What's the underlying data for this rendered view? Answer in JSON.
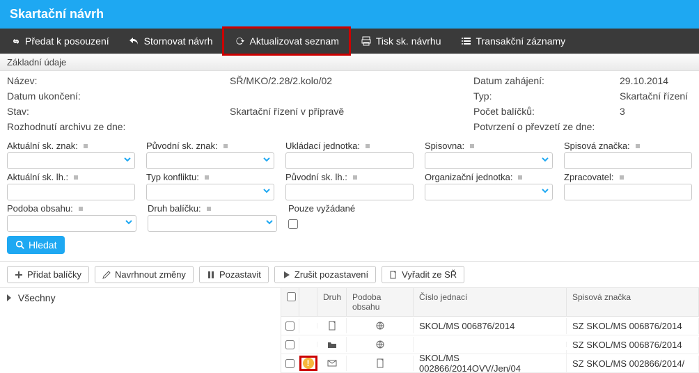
{
  "titlebar": {
    "title": "Skartační návrh"
  },
  "toolbar": {
    "submit": "Předat k posouzení",
    "cancel": "Stornovat návrh",
    "refresh": "Aktualizovat seznam",
    "print": "Tisk sk. návrhu",
    "log": "Transakční záznamy"
  },
  "section": {
    "basic": "Základní údaje"
  },
  "details": {
    "name_label": "Název:",
    "name_value": "SŘ/MKO/2.28/2.kolo/02",
    "start_label": "Datum zahájení:",
    "start_value": "29.10.2014",
    "end_label": "Datum ukončení:",
    "type_label": "Typ:",
    "type_value": "Skartační řízení",
    "state_label": "Stav:",
    "state_value": "Skartační řízení v přípravě",
    "count_label": "Počet balíčků:",
    "count_value": "3",
    "dec_label": "Rozhodnutí archivu ze dne:",
    "conf_label": "Potvrzení o převzetí ze dne:"
  },
  "filters": {
    "akt_znak": "Aktuální sk. znak:",
    "puv_znak": "Původní sk. znak:",
    "ukl_j": "Ukládací jednotka:",
    "spisovna": "Spisovna:",
    "sp_znacka": "Spisová značka:",
    "akt_lh": "Aktuální sk. lh.:",
    "typ_konf": "Typ konfliktu:",
    "puv_lh": "Původní sk. lh.:",
    "org_j": "Organizační jednotka:",
    "zprac": "Zpracovatel:",
    "podoba": "Podoba obsahu:",
    "druh_b": "Druh balíčku:",
    "pouze": "Pouze vyžádané",
    "search": "Hledat"
  },
  "actions": {
    "add": "Přidat balíčky",
    "propose": "Navrhnout změny",
    "pause": "Pozastavit",
    "unpause": "Zrušit pozastavení",
    "remove": "Vyřadit ze SŘ"
  },
  "side": {
    "all": "Všechny"
  },
  "grid": {
    "headers": {
      "druh": "Druh",
      "podoba": "Podoba obsahu",
      "cj": "Číslo jednací",
      "sz": "Spisová značka"
    },
    "rows": [
      {
        "warn": false,
        "druh": "doc",
        "podoba": "globe",
        "cj": "SKOL/MS 006876/2014",
        "sz": "SZ SKOL/MS 006876/2014"
      },
      {
        "warn": false,
        "druh": "folder",
        "podoba": "globe",
        "cj": "",
        "sz": "SZ SKOL/MS 006876/2014"
      },
      {
        "warn": true,
        "druh": "mail",
        "podoba": "doc",
        "cj": "SKOL/MS 002866/2014OVV/Jen/04",
        "sz": "SZ SKOL/MS 002866/2014/"
      }
    ]
  }
}
